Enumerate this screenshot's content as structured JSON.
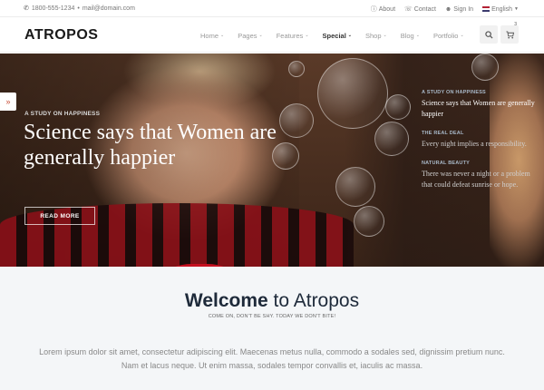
{
  "topbar": {
    "phone": "1800-555-1234",
    "separator": "•",
    "email": "mail@domain.com",
    "about": "About",
    "contact": "Contact",
    "signin": "Sign In",
    "language": "English"
  },
  "header": {
    "logo": "ATROPOS",
    "nav": [
      {
        "label": "Home"
      },
      {
        "label": "Pages"
      },
      {
        "label": "Features"
      },
      {
        "label": "Special"
      },
      {
        "label": "Shop"
      },
      {
        "label": "Blog"
      },
      {
        "label": "Portfolio"
      }
    ],
    "cart_count": "3"
  },
  "hero": {
    "kicker": "A STUDY ON HAPPINESS",
    "title": "Science says that Women are generally happier",
    "button": "READ MORE",
    "side_arrow": "»"
  },
  "stories": [
    {
      "kicker": "A STUDY ON HAPPINESS",
      "title": "Science says that Women are generally happier"
    },
    {
      "kicker": "THE REAL DEAL",
      "title": "Every night implies a responsibility."
    },
    {
      "kicker": "NATURAL BEAUTY",
      "title": "There was never a night or a problem that could defeat sunrise or hope."
    }
  ],
  "welcome": {
    "title_strong": "Welcome",
    "title_rest": " to Atropos",
    "subtitle": "COME ON, DON'T BE SHY. TODAY WE DON'T BITE!",
    "body": "Lorem ipsum dolor sit amet, consectetur adipiscing elit. Maecenas metus nulla, commodo a sodales sed, dignissim pretium nunc. Nam et lacus neque. Ut enim massa, sodales tempor convallis et, iaculis ac massa."
  }
}
